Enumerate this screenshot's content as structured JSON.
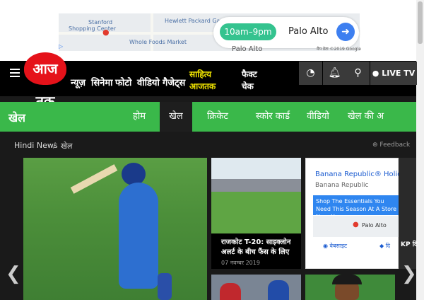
{
  "ad": {
    "hours": "10am–9pm",
    "location": "Palo Alto",
    "location_bottom": "Palo Alto",
    "credit": "मैप डेटा ©2019 Google",
    "map_labels": [
      "Stanford",
      "Shopping Center",
      "Hewlett Packard Garage",
      "Whole Foods Market"
    ],
    "directions_icon": "directions-arrow-icon"
  },
  "header": {
    "logo": "आज तक",
    "nav": [
      "न्यूज़",
      "सिनेमा",
      "फोटो",
      "वीडियो",
      "गैजेट्स"
    ],
    "sahitya": [
      "साहित्य",
      "आजतक"
    ],
    "fact": [
      "फैक्ट",
      "चेक"
    ],
    "live_tv": "● LIVE TV",
    "icons": [
      "speedometer-icon",
      "bell-icon",
      "search-icon"
    ]
  },
  "sportbar": {
    "title": "खेल",
    "tabs": [
      "होम",
      "खेल",
      "क्रिकेट",
      "स्कोर कार्ड",
      "वीडियो",
      "खेल की अ"
    ],
    "active_tab": "खेल"
  },
  "breadcrumb": {
    "home": "Hindi News",
    "separator": "/",
    "current": "खेल",
    "feedback": "Feedback"
  },
  "cards": {
    "card2_title": "राजकोट T-20: साइक्लोन अलर्ट के बीच फैंस के लिए",
    "card2_date": "07 नवम्बर 2019"
  },
  "ad_card": {
    "title": "Banana Republic® Holiday",
    "subtitle": "Banana Republic",
    "cta": "Shop The Essentials You Need This Season At A Store Near You",
    "pin_label": "Palo Alto",
    "button1": "वेबसाइट",
    "button2": "दि"
  },
  "side_card": {
    "text": "KP दि"
  },
  "colors": {
    "brand_red": "#e5121a",
    "sport_green": "#3ab84a",
    "header_black": "#000000",
    "yellow": "#f2e600"
  }
}
